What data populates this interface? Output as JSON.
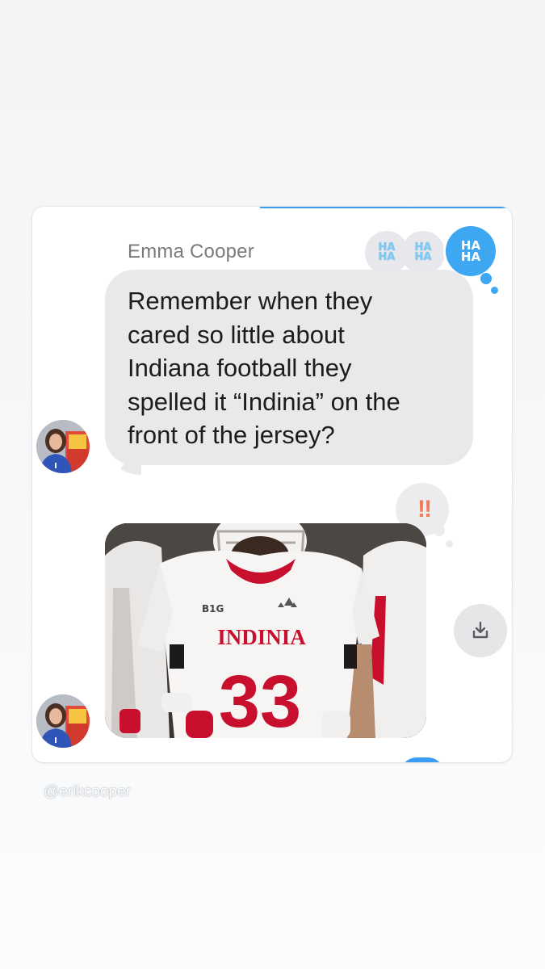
{
  "message": {
    "sender": "Emma Cooper",
    "lines": [
      "Remember when they",
      "cared so little about",
      "Indiana football they",
      "spelled it “Indinia” on the",
      "front of the jersey?"
    ]
  },
  "reactions": {
    "haha_label_top": "HA",
    "haha_label_bottom": "HA",
    "exclaim_label": "‼"
  },
  "photo": {
    "jersey_text": "INDINIA",
    "jersey_number": "33",
    "patch": "B1G"
  },
  "icons": {
    "save": "download-icon"
  },
  "colors": {
    "accent": "#3ea7f2",
    "bubble": "#e9e9eb",
    "jersey_red": "#c8102e"
  },
  "watermark": "@erikcooper"
}
